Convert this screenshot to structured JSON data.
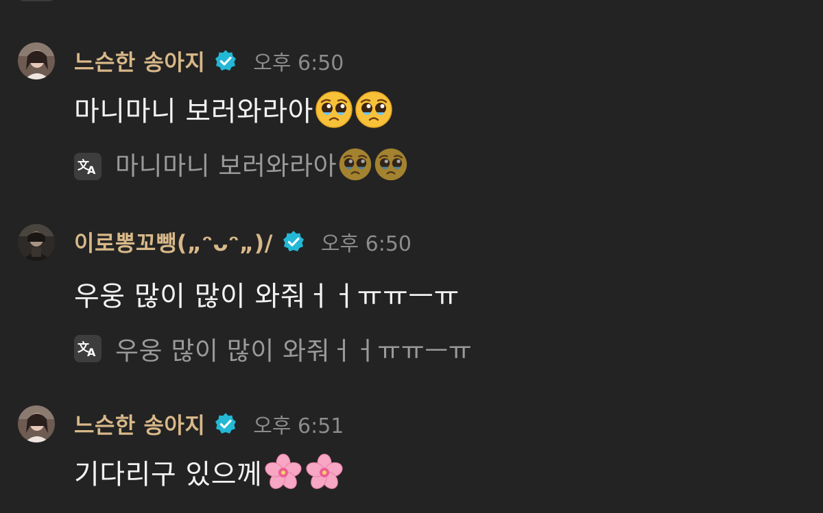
{
  "messages": [
    {
      "username": "느슨한 송아지",
      "timestamp": "오후 6:50",
      "verified": true,
      "text": "마니마니 보러와라아",
      "emojis": [
        "pleading-face",
        "pleading-face"
      ],
      "translation": "마니마니 보러와라아",
      "translation_emojis": [
        "pleading-face",
        "pleading-face"
      ]
    },
    {
      "username": "이로뽕꼬뺑(„ᵔᴗᵔ„)/",
      "timestamp": "오후 6:50",
      "verified": true,
      "text": "우웅 많이 많이 와줘ㅓㅓㅠㅠㅡㅠ",
      "emojis": [],
      "translation": "우웅 많이 많이 와줘ㅓㅓㅠㅠㅡㅠ",
      "translation_emojis": []
    },
    {
      "username": "느슨한 송아지",
      "timestamp": "오후 6:51",
      "verified": true,
      "text": "기다리구 있으께",
      "emojis": [
        "cherry-blossom",
        "cherry-blossom"
      ]
    }
  ],
  "colors": {
    "background": "#232323",
    "username": "#d8b889",
    "verified_badge": "#23b8d6",
    "timestamp": "#8c8c8c",
    "message_text": "#f2f2f2",
    "translation_text": "#9a9a9a"
  }
}
